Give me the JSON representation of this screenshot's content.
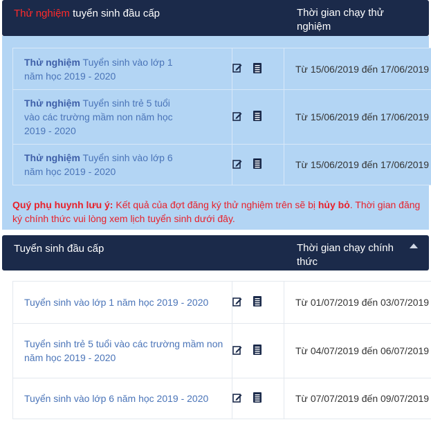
{
  "trial": {
    "header": {
      "title_highlight": "Thử nghiệm",
      "title_rest": " tuyển sinh đầu cấp",
      "time_col": "Thời gian chạy thử nghiệm"
    },
    "rows": [
      {
        "prefix": "Thử nghiệm",
        "name": " Tuyển sinh vào lớp 1 năm học 2019 - 2020",
        "time": "Từ 15/06/2019 đến 17/06/2019"
      },
      {
        "prefix": "Thử nghiệm",
        "name": " Tuyển sinh trẻ 5 tuổi vào các trường mầm non năm học 2019 - 2020",
        "time": "Từ 15/06/2019 đến 17/06/2019"
      },
      {
        "prefix": "Thử nghiệm",
        "name": " Tuyển sinh vào lớp 6 năm học 2019 - 2020",
        "time": "Từ 15/06/2019 đến 17/06/2019"
      }
    ],
    "note": {
      "label": "Quý phụ huynh lưu ý:",
      "text1": " Kết quả của đợt đăng ký thử nghiệm trên sẽ bị ",
      "cancel": "hủy bỏ",
      "text2": ". Thời gian đăng ký chính thức vui lòng xem lịch tuyển sinh dưới đây."
    }
  },
  "official": {
    "header": {
      "title": "Tuyển sinh đầu cấp",
      "time_col": "Thời gian chạy chính thức"
    },
    "rows": [
      {
        "name": "Tuyển sinh vào lớp 1 năm học 2019 - 2020",
        "time": "Từ 01/07/2019 đến 03/07/2019"
      },
      {
        "name": "Tuyển sinh trẻ 5 tuổi vào các trường mầm non năm học 2019 - 2020",
        "time": "Từ 04/07/2019 đến 06/07/2019"
      },
      {
        "name": "Tuyển sinh vào lớp 6 năm học 2019 - 2020",
        "time": "Từ 07/07/2019 đến 09/07/2019"
      }
    ]
  },
  "icons": {
    "edit": "edit-icon",
    "document": "document-icon",
    "collapse": "caret-up-icon"
  },
  "colors": {
    "header_bg": "#1b2a4a",
    "trial_bg": "#b3d5f4",
    "link": "#4a74b8",
    "warning": "#e8212b"
  }
}
